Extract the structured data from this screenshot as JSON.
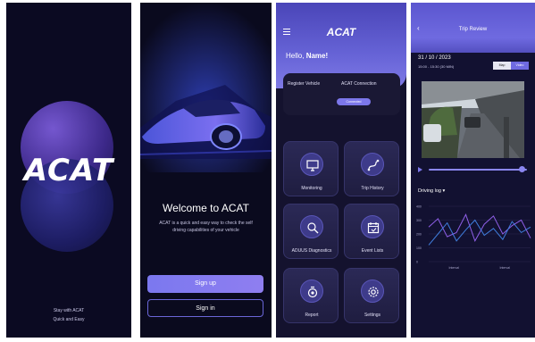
{
  "splash": {
    "logo": "ACAT",
    "tagline_1": "Stay with ACAT",
    "tagline_2": "Quick and Easy"
  },
  "welcome": {
    "title": "Welcome to ACAT",
    "body": "ACAT is a quick and easy way to check the self driving capabilities of your vehicle",
    "signup_label": "Sign up",
    "signin_label": "Sign in"
  },
  "dashboard": {
    "logo": "ACAT",
    "greeting": "Hello,",
    "name": "Name!",
    "register_label": "Register Vehicle",
    "connection_label": "ACAT Connection",
    "connect_label": "Connected",
    "tiles": [
      {
        "label": "Monitoring",
        "icon": "monitor-icon"
      },
      {
        "label": "Trip History",
        "icon": "route-icon"
      },
      {
        "label": "ADUUS Diagnostics",
        "icon": "diagnostics-icon"
      },
      {
        "label": "Event Lists",
        "icon": "calendar-icon"
      },
      {
        "label": "Report",
        "icon": "report-icon"
      },
      {
        "label": "Settings",
        "icon": "gear-icon"
      }
    ]
  },
  "trip": {
    "title": "Trip Review",
    "date": "31 / 10 / 2023",
    "time": "15:00 - 15:30 (30 MIN)",
    "seg_a": "Map",
    "seg_b": "Video",
    "log_label": "Driving log",
    "y_ticks": [
      "400",
      "300",
      "200",
      "100",
      "0"
    ],
    "x_ticks": [
      "Interval",
      "Interval"
    ]
  },
  "colors": {
    "accent": "#7c77ea",
    "background": "#0c0a24",
    "series_1": "#8f5fe8",
    "series_2": "#3f7ddc"
  },
  "chart_data": {
    "type": "line",
    "ylim": [
      0,
      400
    ],
    "series": [
      {
        "values": [
          250,
          310,
          180,
          210,
          340,
          150,
          270,
          330,
          200,
          260,
          300,
          170
        ]
      },
      {
        "values": [
          120,
          200,
          280,
          150,
          230,
          300,
          190,
          240,
          160,
          290,
          210,
          250
        ]
      }
    ]
  }
}
